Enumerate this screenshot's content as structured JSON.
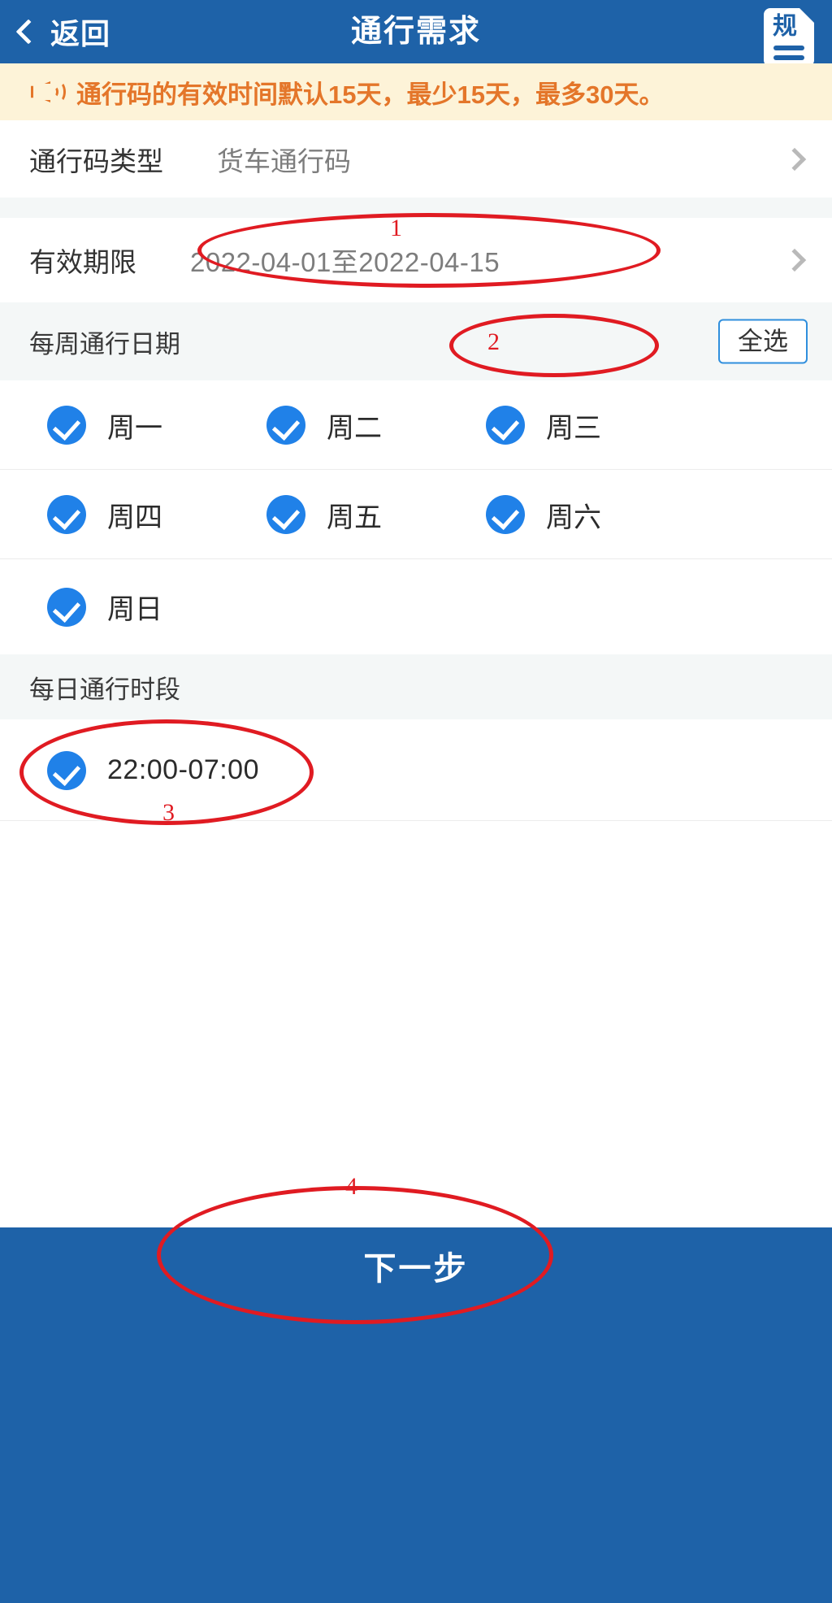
{
  "header": {
    "back_label": "返回",
    "title": "通行需求",
    "rules_icon_char": "规",
    "accent_color": "#1e62a8"
  },
  "alert": {
    "text": "通行码的有效时间默认15天，最少15天，最多30天。",
    "text_color": "#e4762a",
    "background_color": "#fdf3d8",
    "icon": "speaker-icon"
  },
  "rows": [
    {
      "label": "通行码类型",
      "value": "货车通行码"
    },
    {
      "label": "有效期限",
      "value": "2022-04-01至2022-04-15"
    }
  ],
  "weekly_section": {
    "title": "每周通行日期",
    "select_all_label": "全选",
    "select_all_border_color": "#2f8fdd",
    "days": [
      {
        "label": "周一",
        "checked": true
      },
      {
        "label": "周二",
        "checked": true
      },
      {
        "label": "周三",
        "checked": true
      },
      {
        "label": "周四",
        "checked": true
      },
      {
        "label": "周五",
        "checked": true
      },
      {
        "label": "周六",
        "checked": true
      },
      {
        "label": "周日",
        "checked": true
      }
    ]
  },
  "daily_section": {
    "title": "每日通行时段",
    "slots": [
      {
        "label": "22:00-07:00",
        "checked": true
      }
    ]
  },
  "footer": {
    "next_label": "下一步"
  },
  "annotations": [
    {
      "number": "1",
      "target": "valid-period-row"
    },
    {
      "number": "2",
      "target": "select-all-button"
    },
    {
      "number": "3",
      "target": "time-slot-22-07"
    },
    {
      "number": "4",
      "target": "next-step-button"
    }
  ]
}
